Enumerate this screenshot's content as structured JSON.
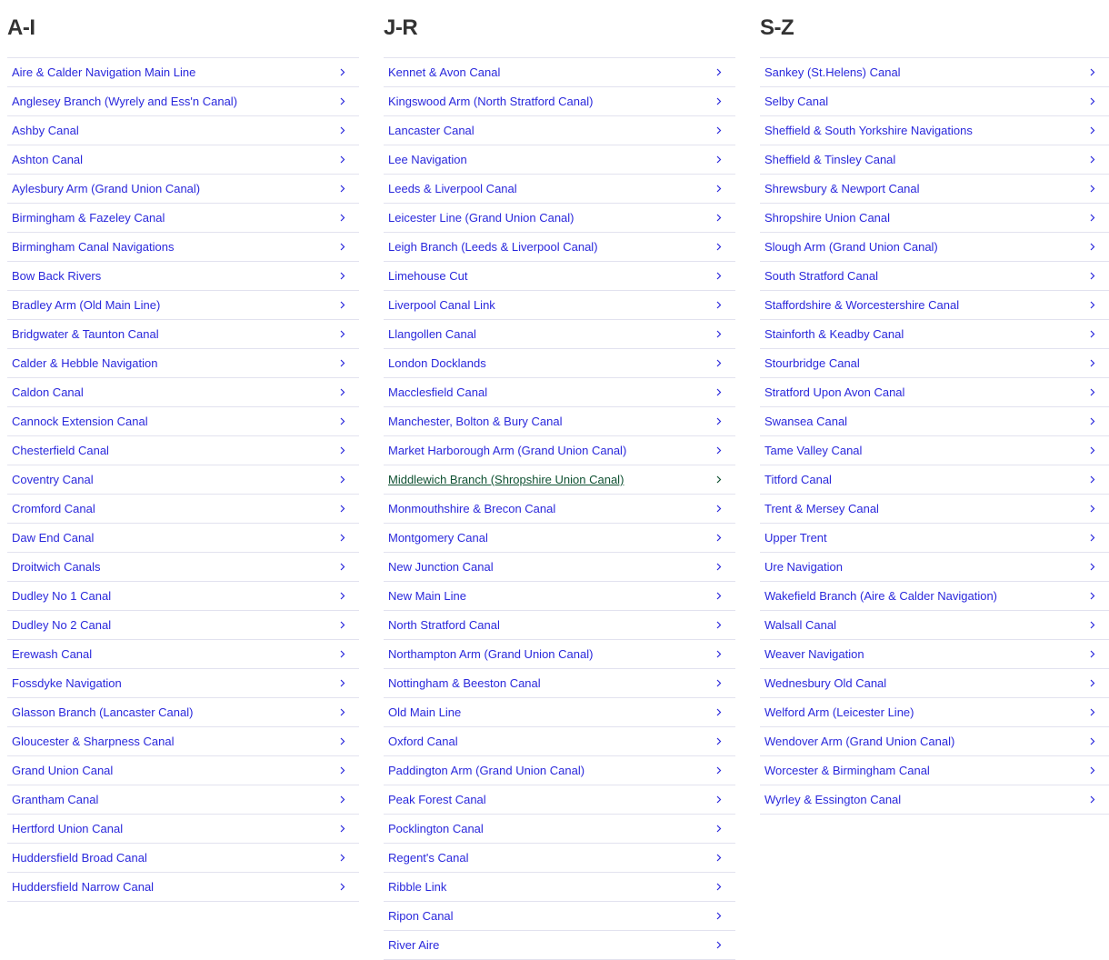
{
  "colors": {
    "link": "#2a28dc",
    "link_hover": "#0f5132",
    "heading": "#333333",
    "divider": "#e2e2ef"
  },
  "columns": [
    {
      "heading": "A-I",
      "items": [
        "Aire & Calder Navigation Main Line",
        "Anglesey Branch (Wyrely and Ess'n Canal)",
        "Ashby Canal",
        "Ashton Canal",
        "Aylesbury Arm (Grand Union Canal)",
        "Birmingham & Fazeley Canal",
        "Birmingham Canal Navigations",
        "Bow Back Rivers",
        "Bradley Arm (Old Main Line)",
        "Bridgwater & Taunton Canal",
        "Calder & Hebble Navigation",
        "Caldon Canal",
        "Cannock Extension Canal",
        "Chesterfield Canal",
        "Coventry Canal",
        "Cromford Canal",
        "Daw End Canal",
        "Droitwich Canals",
        "Dudley No 1 Canal",
        "Dudley No 2 Canal",
        "Erewash Canal",
        "Fossdyke Navigation",
        "Glasson Branch (Lancaster Canal)",
        "Gloucester & Sharpness Canal",
        "Grand Union Canal",
        "Grantham Canal",
        "Hertford Union Canal",
        "Huddersfield Broad Canal",
        "Huddersfield Narrow Canal"
      ]
    },
    {
      "heading": "J-R",
      "hovered_index": 14,
      "items": [
        "Kennet & Avon Canal",
        "Kingswood Arm (North Stratford Canal)",
        "Lancaster Canal",
        "Lee Navigation",
        "Leeds & Liverpool Canal",
        "Leicester Line (Grand Union Canal)",
        "Leigh Branch (Leeds & Liverpool Canal)",
        "Limehouse Cut",
        "Liverpool Canal Link",
        "Llangollen Canal",
        "London Docklands",
        "Macclesfield Canal",
        "Manchester, Bolton & Bury Canal",
        "Market Harborough Arm (Grand Union Canal)",
        "Middlewich Branch (Shropshire Union Canal)",
        "Monmouthshire & Brecon Canal",
        "Montgomery Canal",
        "New Junction Canal",
        "New Main Line",
        "North Stratford Canal",
        "Northampton Arm (Grand Union Canal)",
        "Nottingham & Beeston Canal",
        "Old Main Line",
        "Oxford Canal",
        "Paddington Arm (Grand Union Canal)",
        "Peak Forest Canal",
        "Pocklington Canal",
        "Regent's Canal",
        "Ribble Link",
        "Ripon Canal",
        "River Aire"
      ]
    },
    {
      "heading": "S-Z",
      "items": [
        "Sankey (St.Helens) Canal",
        "Selby Canal",
        "Sheffield & South Yorkshire Navigations",
        "Sheffield & Tinsley Canal",
        "Shrewsbury & Newport Canal",
        "Shropshire Union Canal",
        "Slough Arm (Grand Union Canal)",
        "South Stratford Canal",
        "Staffordshire & Worcestershire Canal",
        "Stainforth & Keadby Canal",
        "Stourbridge Canal",
        "Stratford Upon Avon Canal",
        "Swansea Canal",
        "Tame Valley Canal",
        "Titford Canal",
        "Trent & Mersey Canal",
        "Upper Trent",
        "Ure Navigation",
        "Wakefield Branch (Aire & Calder Navigation)",
        "Walsall Canal",
        "Weaver Navigation",
        "Wednesbury Old Canal",
        "Welford Arm (Leicester Line)",
        "Wendover Arm (Grand Union Canal)",
        "Worcester & Birmingham Canal",
        "Wyrley & Essington Canal"
      ]
    }
  ],
  "icons": {
    "row_chevron": "chevron-right-icon"
  }
}
